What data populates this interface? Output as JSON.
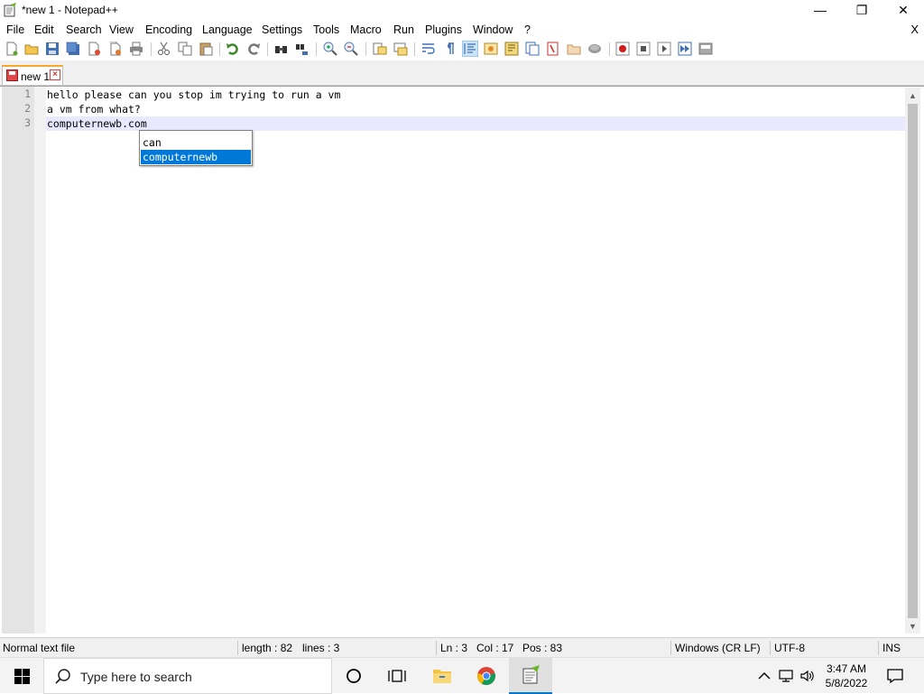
{
  "window": {
    "title": "*new 1 - Notepad++",
    "min_glyph": "—",
    "max_glyph": "❐",
    "close_glyph": "✕"
  },
  "menu": {
    "items": [
      "File",
      "Edit",
      "Search",
      "View",
      "Encoding",
      "Language",
      "Settings",
      "Tools",
      "Macro",
      "Run",
      "Plugins",
      "Window",
      "?"
    ],
    "close_doc": "X"
  },
  "toolbar_icons": [
    "new-file-icon",
    "open-file-icon",
    "save-icon",
    "save-all-icon",
    "close-icon",
    "close-all-icon",
    "print-icon",
    "cut-icon",
    "copy-icon",
    "paste-icon",
    "undo-icon",
    "redo-icon",
    "find-icon",
    "replace-icon",
    "zoom-in-icon",
    "zoom-out-icon",
    "sync-v-icon",
    "sync-h-icon",
    "word-wrap-icon",
    "show-all-chars-icon",
    "indent-guide-icon",
    "doc-map-icon",
    "function-list-icon",
    "folder-workspace-icon",
    "monitor-icon",
    "record-macro-icon",
    "stop-macro-icon",
    "play-macro-icon",
    "run-macro-multiple-icon",
    "save-macro-icon"
  ],
  "tabs": [
    {
      "label": "new 1",
      "close": "×"
    }
  ],
  "editor": {
    "lines": [
      {
        "num": "1",
        "text": "hello please can you stop im trying to run a vm"
      },
      {
        "num": "2",
        "text": "a vm from what?"
      },
      {
        "num": "3",
        "text": "computernewb.com"
      }
    ],
    "current_line_color": "#e8e8ff"
  },
  "autocomplete": {
    "items": [
      "can",
      "computernewb"
    ],
    "selected_index": 1,
    "selected_color": "#0078d7"
  },
  "statusbar": {
    "file_type": "Normal text file",
    "length": "length : 82",
    "lines": "lines : 3",
    "ln": "Ln : 3",
    "col": "Col : 17",
    "pos": "Pos : 83",
    "eol": "Windows (CR LF)",
    "encoding": "UTF-8",
    "mode": "INS"
  },
  "taskbar": {
    "search_placeholder": "Type here to search",
    "time": "3:47 AM",
    "date": "5/8/2022"
  }
}
